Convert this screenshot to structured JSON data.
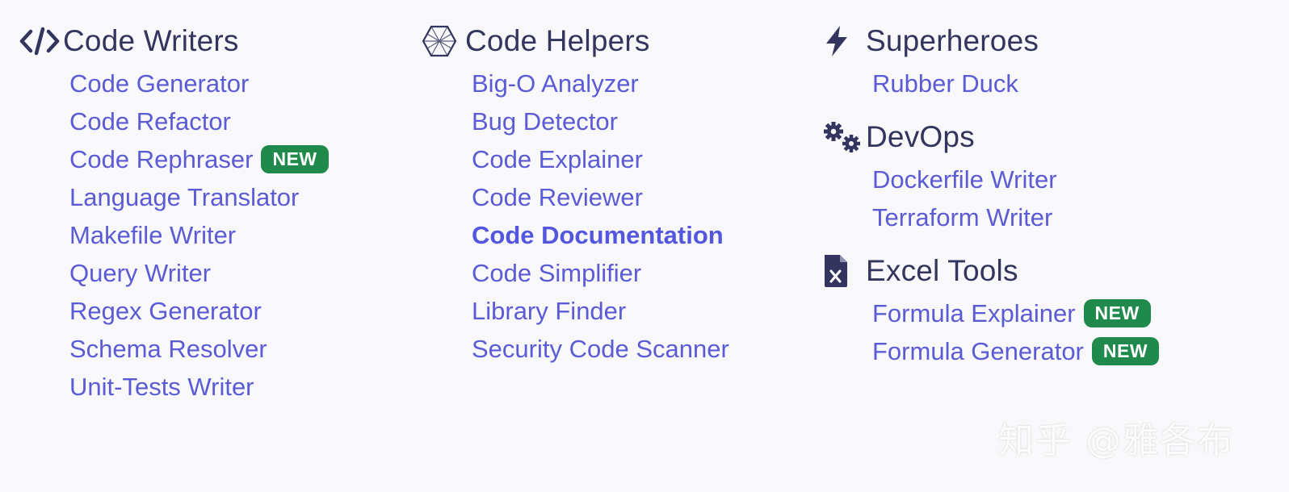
{
  "colors": {
    "background": "#f8f8fa",
    "heading": "#34355f",
    "link": "#5b5bd6",
    "badge": "#1f8a4c"
  },
  "columns": [
    {
      "groups": [
        {
          "title": "Code Writers",
          "icon": "code-icon",
          "items": [
            {
              "label": "Code Generator"
            },
            {
              "label": "Code Refactor"
            },
            {
              "label": "Code Rephraser",
              "badge": "NEW"
            },
            {
              "label": "Language Translator"
            },
            {
              "label": "Makefile Writer"
            },
            {
              "label": "Query Writer"
            },
            {
              "label": "Regex Generator"
            },
            {
              "label": "Schema Resolver"
            },
            {
              "label": "Unit-Tests Writer"
            }
          ]
        }
      ]
    },
    {
      "groups": [
        {
          "title": "Code Helpers",
          "icon": "polyhedron-icon",
          "items": [
            {
              "label": "Big-O Analyzer"
            },
            {
              "label": "Bug Detector"
            },
            {
              "label": "Code Explainer"
            },
            {
              "label": "Code Reviewer"
            },
            {
              "label": "Code Documentation",
              "active": true
            },
            {
              "label": "Code Simplifier"
            },
            {
              "label": "Library Finder"
            },
            {
              "label": "Security Code Scanner"
            }
          ]
        }
      ]
    },
    {
      "groups": [
        {
          "title": "Superheroes",
          "icon": "lightning-icon",
          "items": [
            {
              "label": "Rubber Duck"
            }
          ]
        },
        {
          "title": "DevOps",
          "icon": "gears-icon",
          "items": [
            {
              "label": "Dockerfile Writer"
            },
            {
              "label": "Terraform Writer"
            }
          ]
        },
        {
          "title": "Excel Tools",
          "icon": "excel-file-icon",
          "items": [
            {
              "label": "Formula Explainer",
              "badge": "NEW"
            },
            {
              "label": "Formula Generator",
              "badge": "NEW"
            }
          ]
        }
      ]
    }
  ],
  "watermark": "知乎 @雅各布"
}
